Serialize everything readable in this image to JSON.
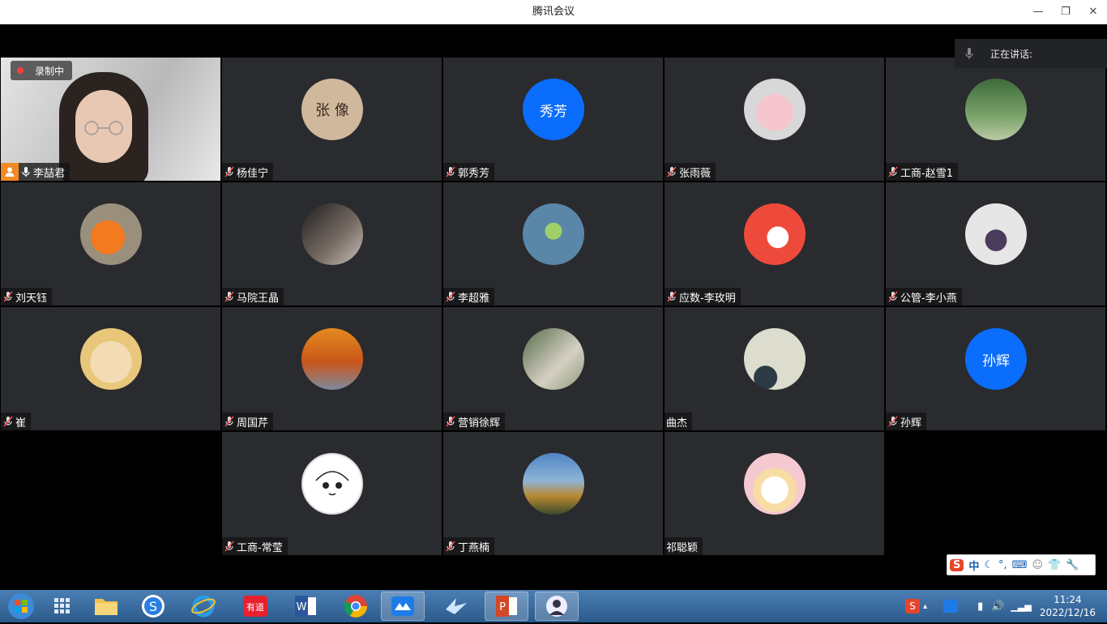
{
  "window": {
    "title": "腾讯会议",
    "minimize": "—",
    "restore": "❐",
    "close": "✕"
  },
  "speaking": {
    "label": "正在讲话:"
  },
  "recording": {
    "label": "录制中"
  },
  "participants": [
    {
      "name": "李喆君",
      "self": true
    },
    {
      "name": "杨佳宁",
      "avatar_text": "张 像"
    },
    {
      "name": "郭秀芳",
      "avatar_text": "秀芳"
    },
    {
      "name": "张雨薇"
    },
    {
      "name": "工商-赵雪1"
    },
    {
      "name": "刘天钰"
    },
    {
      "name": "马院王晶"
    },
    {
      "name": "李超雅"
    },
    {
      "name": "应数-李玫明"
    },
    {
      "name": "公管-李小燕"
    },
    {
      "name": "崔"
    },
    {
      "name": "周国芹"
    },
    {
      "name": "营销徐辉"
    },
    {
      "name": "曲杰"
    },
    {
      "name": "孙辉",
      "avatar_text": "孙辉"
    },
    {
      "name": "工商-常莹"
    },
    {
      "name": "丁燕楠"
    },
    {
      "name": "祁聪颖"
    }
  ],
  "ime": {
    "items": [
      "S",
      "中",
      "☾",
      "°,",
      "⌨",
      "☺",
      "👕",
      "🔧"
    ]
  },
  "taskbar": {
    "time": "11:24",
    "date": "2022/12/16"
  },
  "colors": {
    "avatar_blue": "#0a6dfb",
    "tile_bg": "#2a2b2e",
    "taskbar": "#2b5a8c"
  }
}
